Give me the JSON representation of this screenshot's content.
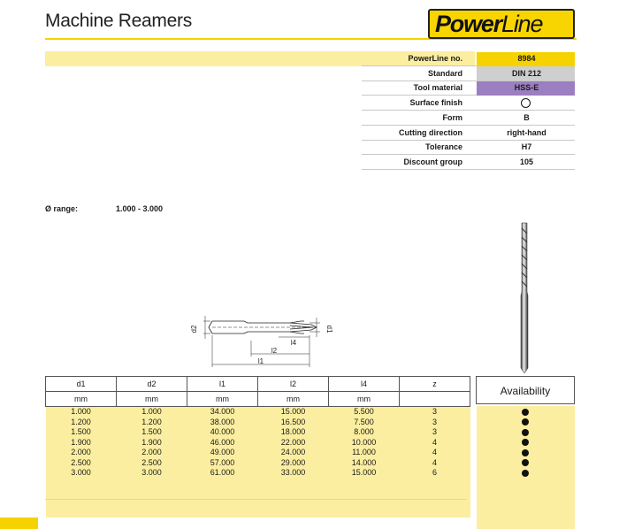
{
  "header": {
    "title": "Machine Reamers",
    "brand_bold": "Power",
    "brand_light": "Line"
  },
  "specs": [
    {
      "label": "PowerLine no.",
      "value": "8984",
      "bg": "#f5d200"
    },
    {
      "label": "Standard",
      "value": "DIN 212",
      "bg": "#cfcfcf"
    },
    {
      "label": "Tool material",
      "value": "HSS-E",
      "bg": "#9b7fc0"
    },
    {
      "label": "Surface finish",
      "value": "",
      "icon": "empty-circle-icon"
    },
    {
      "label": "Form",
      "value": "B"
    },
    {
      "label": "Cutting direction",
      "value": "right-hand"
    },
    {
      "label": "Tolerance",
      "value": "H7"
    },
    {
      "label": "Discount group",
      "value": "105"
    }
  ],
  "range": {
    "label": "Ø range:",
    "value": "1.000 - 3.000"
  },
  "drawing": {
    "labels": [
      "d2",
      "d1",
      "l4",
      "l2",
      "l1"
    ]
  },
  "table": {
    "headers": [
      "d1",
      "d2",
      "l1",
      "l2",
      "l4",
      "z"
    ],
    "units": [
      "mm",
      "mm",
      "mm",
      "mm",
      "mm",
      ""
    ],
    "rows": [
      [
        "1.000",
        "1.000",
        "34.000",
        "15.000",
        "5.500",
        "3"
      ],
      [
        "1.200",
        "1.200",
        "38.000",
        "16.500",
        "7.500",
        "3"
      ],
      [
        "1.500",
        "1.500",
        "40.000",
        "18.000",
        "8.000",
        "3"
      ],
      [
        "1.900",
        "1.900",
        "46.000",
        "22.000",
        "10.000",
        "4"
      ],
      [
        "2.000",
        "2.000",
        "49.000",
        "24.000",
        "11.000",
        "4"
      ],
      [
        "2.500",
        "2.500",
        "57.000",
        "29.000",
        "14.000",
        "4"
      ],
      [
        "3.000",
        "3.000",
        "61.000",
        "33.000",
        "15.000",
        "6"
      ]
    ],
    "availability_header": "Availability",
    "availability": [
      true,
      true,
      true,
      true,
      true,
      true,
      true
    ]
  },
  "colors": {
    "accent_yellow": "#f5d200",
    "band_yellow": "#fbeea0",
    "grey": "#cfcfcf",
    "purple": "#9b7fc0"
  }
}
